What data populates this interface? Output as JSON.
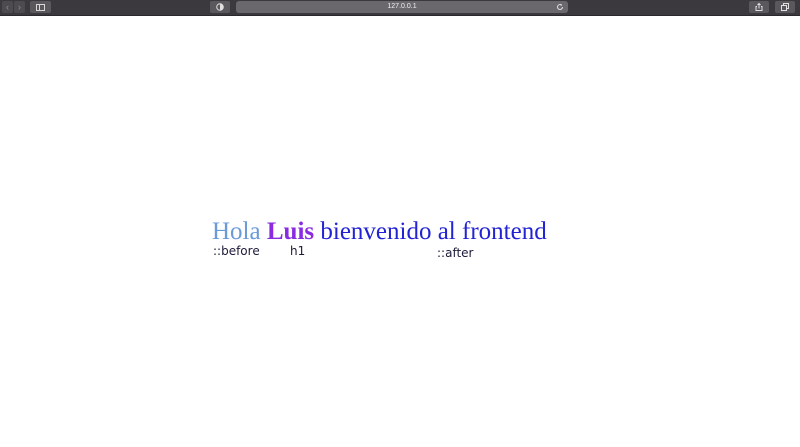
{
  "browser": {
    "back_icon": "chevron-left-icon",
    "forward_icon": "chevron-right-icon",
    "address": "127.0.0.1"
  },
  "page": {
    "before_text": "Hola",
    "name_text": "Luis",
    "after_text": "bienvenido al frontend",
    "label_before": "::before",
    "label_h1": "h1",
    "label_after": "::after"
  },
  "colors": {
    "before": "#6a9ad8",
    "name": "#8a2be2",
    "after": "#2323d6"
  }
}
